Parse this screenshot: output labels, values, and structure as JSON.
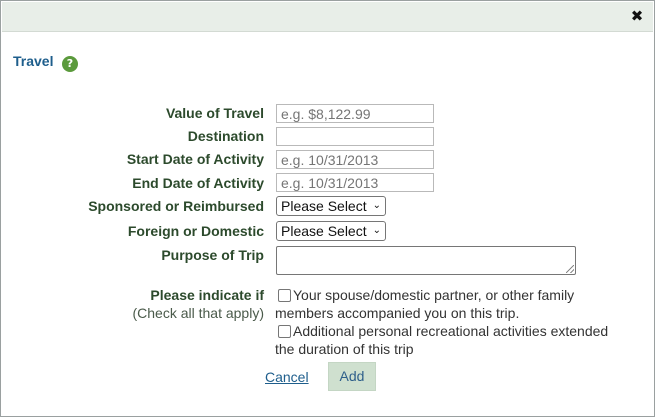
{
  "dialog": {
    "close_icon": "close-icon",
    "close_glyph": "✖"
  },
  "section": {
    "title": "Travel",
    "help_icon": "help-icon",
    "help_glyph": "?"
  },
  "form": {
    "value_of_travel": {
      "label": "Value of Travel",
      "value": "",
      "placeholder": "e.g. $8,122.99"
    },
    "destination": {
      "label": "Destination",
      "value": "",
      "placeholder": ""
    },
    "start_date": {
      "label": "Start Date of Activity",
      "value": "",
      "placeholder": "e.g. 10/31/2013"
    },
    "end_date": {
      "label": "End Date of Activity",
      "value": "",
      "placeholder": "e.g. 10/31/2013"
    },
    "sponsored": {
      "label": "Sponsored or Reimbursed",
      "selected": "Please Select"
    },
    "foreign_domestic": {
      "label": "Foreign or Domestic",
      "selected": "Please Select"
    },
    "purpose": {
      "label": "Purpose of Trip",
      "value": ""
    },
    "indicate": {
      "label": "Please indicate if",
      "sublabel": "(Check all that apply)",
      "options": [
        {
          "line1": "Your spouse/domestic partner, or other family",
          "line2": "members accompanied you on this trip.",
          "checked": false
        },
        {
          "line1": "Additional personal recreational activities extended",
          "line2": "the duration of this trip",
          "checked": false
        }
      ]
    }
  },
  "actions": {
    "cancel_label": "Cancel",
    "add_label": "Add"
  },
  "colors": {
    "link": "#1e5e8c",
    "label": "#2c4a2c",
    "help_icon": "#5b9a3c",
    "titlebar": "#e8eee8",
    "add_button_bg": "#cfe0cf"
  }
}
